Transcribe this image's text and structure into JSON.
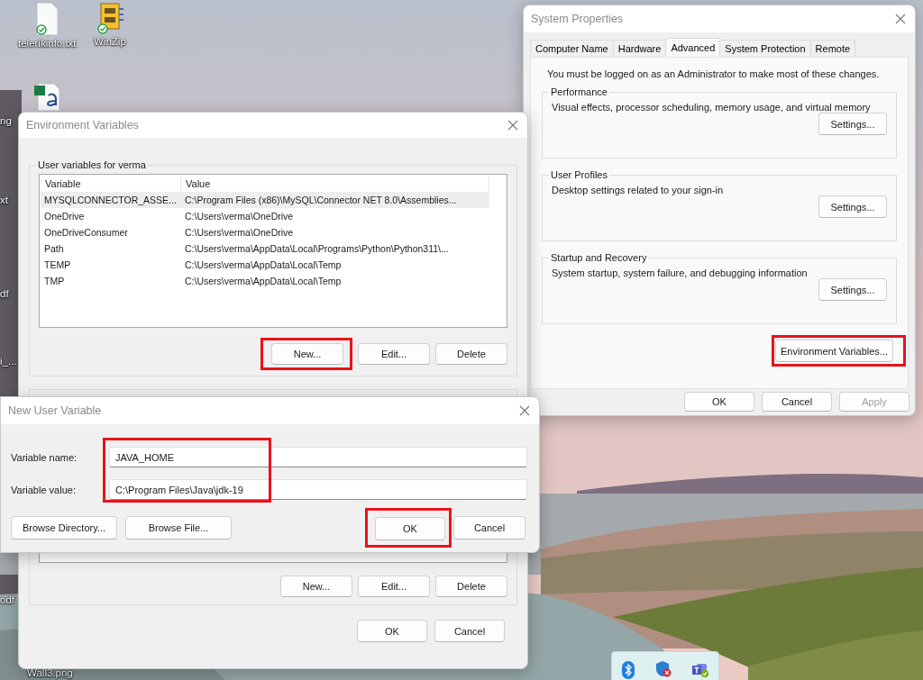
{
  "desktop_icons": [
    {
      "kind": "text-file",
      "label": "telerikinfo.txt"
    },
    {
      "kind": "archive",
      "label": "WinZip"
    },
    {
      "kind": "document"
    },
    {
      "kind": "label-only",
      "label": "ng"
    },
    {
      "kind": "label-only",
      "label": "xt"
    },
    {
      "kind": "label-only",
      "label": "df"
    },
    {
      "kind": "label-only",
      "label": "i_..."
    },
    {
      "kind": "label-only",
      "label": "odf"
    },
    {
      "kind": "label-only",
      "label": "Wall3.png"
    }
  ],
  "system_properties": {
    "title": "System Properties",
    "tabs": [
      {
        "label": "Computer Name",
        "selected": false
      },
      {
        "label": "Hardware",
        "selected": false
      },
      {
        "label": "Advanced",
        "selected": true
      },
      {
        "label": "System Protection",
        "selected": false
      },
      {
        "label": "Remote",
        "selected": false
      }
    ],
    "notice": "You must be logged on as an Administrator to make most of these changes.",
    "groups": [
      {
        "title": "Performance",
        "description": "Visual effects, processor scheduling, memory usage, and virtual memory",
        "button": "Settings..."
      },
      {
        "title": "User Profiles",
        "description": "Desktop settings related to your sign-in",
        "button": "Settings..."
      },
      {
        "title": "Startup and Recovery",
        "description": "System startup, system failure, and debugging information",
        "button": "Settings..."
      }
    ],
    "env_button": {
      "label": "Environment Variables...",
      "highlighted": true
    },
    "buttons": [
      {
        "label": "OK",
        "disabled": false
      },
      {
        "label": "Cancel",
        "disabled": false
      },
      {
        "label": "Apply",
        "disabled": true
      }
    ]
  },
  "environment_variables": {
    "title": "Environment Variables",
    "user_group": {
      "title": "User variables for verma",
      "columns": [
        "Variable",
        "Value"
      ],
      "rows": [
        {
          "variable": "MYSQLCONNECTOR_ASSE...",
          "value": "C:\\Program Files (x86)\\MySQL\\Connector NET 8.0\\Assemblies...",
          "selected": true
        },
        {
          "variable": "OneDrive",
          "value": "C:\\Users\\verma\\OneDrive",
          "selected": false
        },
        {
          "variable": "OneDriveConsumer",
          "value": "C:\\Users\\verma\\OneDrive",
          "selected": false
        },
        {
          "variable": "Path",
          "value": "C:\\Users\\verma\\AppData\\Local\\Programs\\Python\\Python311\\...",
          "selected": false
        },
        {
          "variable": "TEMP",
          "value": "C:\\Users\\verma\\AppData\\Local\\Temp",
          "selected": false
        },
        {
          "variable": "TMP",
          "value": "C:\\Users\\verma\\AppData\\Local\\Temp",
          "selected": false
        }
      ],
      "buttons": [
        {
          "label": "New...",
          "highlighted": true
        },
        {
          "label": "Edit...",
          "highlighted": false
        },
        {
          "label": "Delete",
          "highlighted": false
        }
      ]
    },
    "system_group": {
      "buttons": [
        {
          "label": "New...",
          "highlighted": false
        },
        {
          "label": "Edit...",
          "highlighted": false
        },
        {
          "label": "Delete",
          "highlighted": false
        }
      ]
    },
    "buttons": [
      {
        "label": "OK"
      },
      {
        "label": "Cancel"
      }
    ]
  },
  "new_user_variable": {
    "title": "New User Variable",
    "fields_highlighted": true,
    "fields": [
      {
        "label": "Variable name:",
        "value": "JAVA_HOME"
      },
      {
        "label": "Variable value:",
        "value": "C:\\Program Files\\Java\\jdk-19"
      }
    ],
    "buttons": [
      {
        "label": "Browse Directory...",
        "highlighted": false
      },
      {
        "label": "Browse File...",
        "highlighted": false
      },
      {
        "label": "OK",
        "highlighted": true
      },
      {
        "label": "Cancel",
        "highlighted": false
      }
    ]
  },
  "tray_icons": [
    {
      "kind": "bluetooth"
    },
    {
      "kind": "shield"
    },
    {
      "kind": "teams"
    }
  ]
}
